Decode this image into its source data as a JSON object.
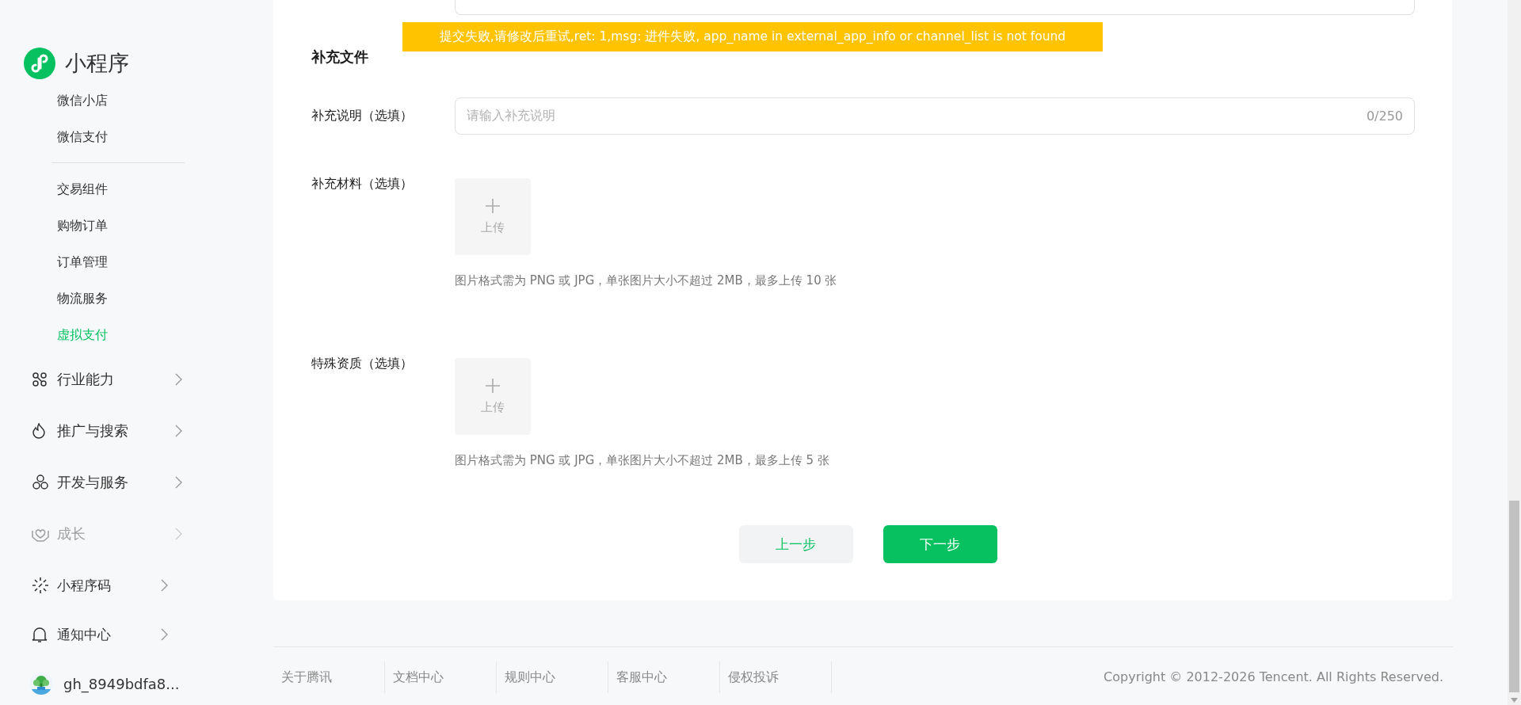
{
  "sidebar": {
    "app_name": "小程序",
    "sub_groups": [
      {
        "items": [
          {
            "label": "微信小店",
            "selected": false
          },
          {
            "label": "微信支付",
            "selected": false
          }
        ]
      },
      {
        "items": [
          {
            "label": "交易组件",
            "selected": false
          },
          {
            "label": "购物订单",
            "selected": false
          },
          {
            "label": "订单管理",
            "selected": false
          },
          {
            "label": "物流服务",
            "selected": false
          },
          {
            "label": "虚拟支付",
            "selected": true
          }
        ]
      }
    ],
    "sections": [
      {
        "label": "行业能力",
        "faded": false
      },
      {
        "label": "推广与搜索",
        "faded": false
      },
      {
        "label": "开发与服务",
        "faded": false
      },
      {
        "label": "成长",
        "faded": true
      }
    ],
    "bottom_items": [
      {
        "label": "小程序码"
      },
      {
        "label": "通知中心"
      }
    ],
    "account": {
      "name": "gh_8949bdfa8..."
    }
  },
  "error_toast": "提交失败,请修改后重试,ret: 1,msg: 进件失败, app_name in external_app_info or channel_list is not found",
  "form": {
    "section_title": "补充文件",
    "fields": [
      {
        "kind": "text",
        "label": "补充说明（选填）",
        "placeholder": "请输入补充说明",
        "counter": "0/250"
      },
      {
        "kind": "upload",
        "label": "补充材料（选填）",
        "button": "上传",
        "hint": "图片格式需为 PNG 或 JPG，单张图片大小不超过 2MB，最多上传 10 张"
      },
      {
        "kind": "upload",
        "label": "特殊资质（选填）",
        "button": "上传",
        "hint": "图片格式需为 PNG 或 JPG，单张图片大小不超过 2MB，最多上传 5 张"
      }
    ],
    "buttons": [
      {
        "label": "上一步",
        "kind": "secondary"
      },
      {
        "label": "下一步",
        "kind": "primary"
      }
    ]
  },
  "footer": {
    "links": [
      "关于腾讯",
      "文档中心",
      "规则中心",
      "客服中心",
      "侵权投诉"
    ],
    "copyright": "Copyright © 2012-2026 Tencent. All Rights Reserved."
  }
}
